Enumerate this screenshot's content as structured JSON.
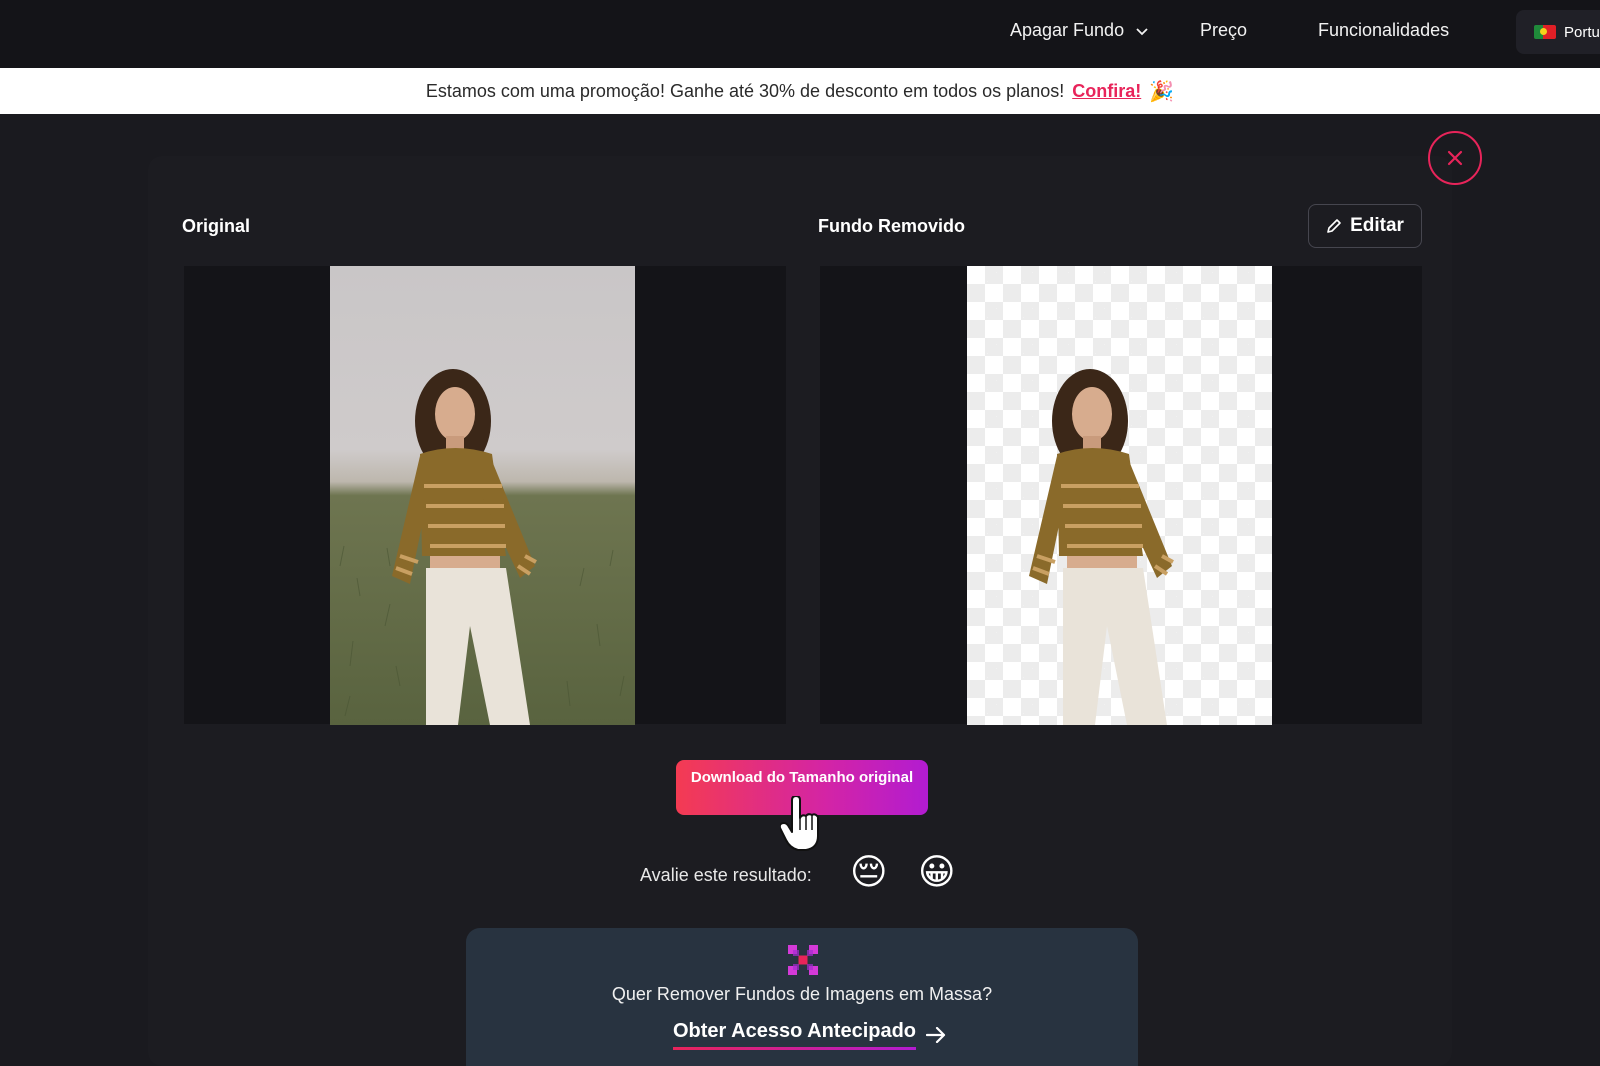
{
  "nav": {
    "items": [
      {
        "label": "Apagar Fundo",
        "dropdown": true
      },
      {
        "label": "Preço"
      },
      {
        "label": "Funcionalidades"
      }
    ],
    "language": "Portu"
  },
  "promo": {
    "text": "Estamos com uma promoção! Ganhe até 30% de desconto em todos os planos!",
    "link": "Confira!",
    "emoji": "🎉"
  },
  "result": {
    "original_label": "Original",
    "removed_label": "Fundo Removido",
    "edit_label": "Editar",
    "download_label": "Download do Tamanho original"
  },
  "rating": {
    "label": "Avalie este resultado:",
    "options": [
      "😔",
      "😀"
    ]
  },
  "bulk": {
    "question": "Quer Remover Fundos de Imagens em Massa?",
    "cta": "Obter Acesso Antecipado"
  },
  "colors": {
    "accent": "#e8245a",
    "gradient_start": "#f43b52",
    "gradient_end": "#b21cd1",
    "background": "#1a1a1f",
    "card": "#283340"
  }
}
